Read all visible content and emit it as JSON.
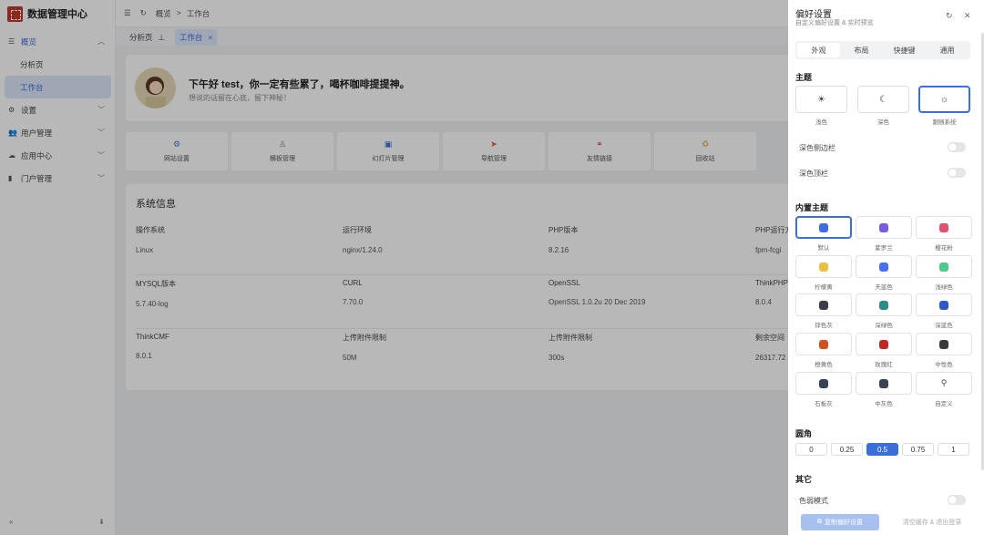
{
  "app": {
    "title": "数据管理中心"
  },
  "sidebar": {
    "items": [
      {
        "label": "概览",
        "icon": "menu-icon"
      },
      {
        "label": "分析页"
      },
      {
        "label": "工作台"
      },
      {
        "label": "设置",
        "icon": "gear-icon"
      },
      {
        "label": "用户管理",
        "icon": "users-icon"
      },
      {
        "label": "应用中心",
        "icon": "cloud-icon"
      },
      {
        "label": "门户管理",
        "icon": "portal-icon"
      }
    ]
  },
  "header": {
    "breadcrumb_root": "概览",
    "breadcrumb_sep": ">",
    "breadcrumb_current": "工作台"
  },
  "tabs": [
    {
      "label": "分析页"
    },
    {
      "label": "工作台"
    }
  ],
  "welcome": {
    "greeting": "下午好 test，你一定有些累了，喝杯咖啡提提神。",
    "subtitle": "想说的话留在心底，留下神秘！"
  },
  "shortcuts": [
    {
      "label": "网站设置",
      "color": "#3a6fd8"
    },
    {
      "label": "横板管理",
      "color": "#888888"
    },
    {
      "label": "幻灯片管理",
      "color": "#3a6fd8"
    },
    {
      "label": "导航管理",
      "color": "#e05a3a"
    },
    {
      "label": "友情链接",
      "color": "#d0456a"
    },
    {
      "label": "回收站",
      "color": "#d8b040"
    }
  ],
  "sysinfo": {
    "title": "系统信息",
    "rows": [
      [
        {
          "k": "操作系统",
          "v": "Linux"
        },
        {
          "k": "运行环境",
          "v": "nginx/1.24.0"
        },
        {
          "k": "PHP版本",
          "v": "8.2.16"
        },
        {
          "k": "PHP运行方",
          "v": "fpm-fcgi"
        }
      ],
      [
        {
          "k": "MYSQL版本",
          "v": "5.7.40-log"
        },
        {
          "k": "CURL",
          "v": "7.70.0"
        },
        {
          "k": "OpenSSL",
          "v": "OpenSSL 1.0.2u 20 Dec 2019"
        },
        {
          "k": "ThinkPHP",
          "v": "8.0.4"
        }
      ],
      [
        {
          "k": "ThinkCMF",
          "v": "8.0.1"
        },
        {
          "k": "上传附件限制",
          "v": "50M"
        },
        {
          "k": "上传附件限制",
          "v": "300s"
        },
        {
          "k": "剩余空间",
          "v": "26317.72"
        }
      ]
    ]
  },
  "drawer": {
    "title": "偏好设置",
    "subtitle": "自定义偏好设置 & 实时预览",
    "segments": [
      "外观",
      "布局",
      "快捷键",
      "通用"
    ],
    "theme_section": "主题",
    "themes": [
      {
        "label": "浅色",
        "icon": "☀"
      },
      {
        "label": "深色",
        "icon": "☾"
      },
      {
        "label": "跟随系统",
        "icon": "☼"
      }
    ],
    "dark_sidebar": "深色侧边栏",
    "dark_header": "深色顶栏",
    "builtin_section": "内置主题",
    "swatches": [
      {
        "label": "默认",
        "color": "#3d6fe0"
      },
      {
        "label": "紫罗兰",
        "color": "#7a5ce0"
      },
      {
        "label": "樱花粉",
        "color": "#e05272"
      },
      {
        "label": "柠檬黄",
        "color": "#e8c048"
      },
      {
        "label": "天蓝色",
        "color": "#4a6ff0"
      },
      {
        "label": "浅绿色",
        "color": "#50c890"
      },
      {
        "label": "锌色灰",
        "color": "#3a3d44"
      },
      {
        "label": "深绿色",
        "color": "#2e8a84"
      },
      {
        "label": "深蓝色",
        "color": "#2e58c8"
      },
      {
        "label": "橙黄色",
        "color": "#d0521c"
      },
      {
        "label": "玫瑰红",
        "color": "#c02828"
      },
      {
        "label": "中性色",
        "color": "#3a3a3a"
      },
      {
        "label": "石板灰",
        "color": "#384156"
      },
      {
        "label": "中灰色",
        "color": "#3a4150"
      },
      {
        "label": "自定义",
        "color": "",
        "icon": "custom-color-icon"
      }
    ],
    "radius_section": "圆角",
    "radius_values": [
      "0",
      "0.25",
      "0.5",
      "0.75",
      "1"
    ],
    "other_section": "其它",
    "color_weak": "色弱模式",
    "copy_button": "复制偏好设置",
    "clear_button": "清空缓存 & 退出登录"
  }
}
